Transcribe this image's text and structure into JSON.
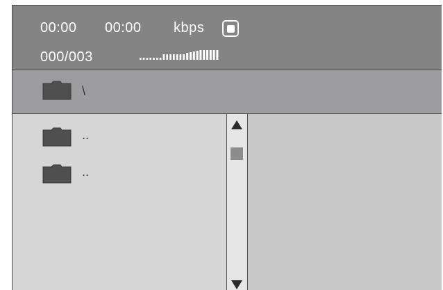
{
  "header": {
    "elapsed_time": "00:00",
    "total_time": "00:00",
    "bitrate_unit": "kbps",
    "track_counter": "000/003",
    "volume_level": 1.0,
    "volume_segments": 24
  },
  "path_bar": {
    "current_path": "\\"
  },
  "file_list": {
    "items": [
      {
        "label": "..",
        "icon": "folder-icon"
      },
      {
        "label": "..",
        "icon": "folder-icon"
      }
    ]
  },
  "scrollbar": {
    "up_icon": "triangle-up-icon",
    "down_icon": "triangle-down-icon"
  },
  "colors": {
    "header_bg": "#848484",
    "path_bg": "#9d9d9f",
    "list_bg": "#d6d6d6",
    "right_pane_bg": "#c8c8c8",
    "folder_fill": "#4f4f4f"
  }
}
